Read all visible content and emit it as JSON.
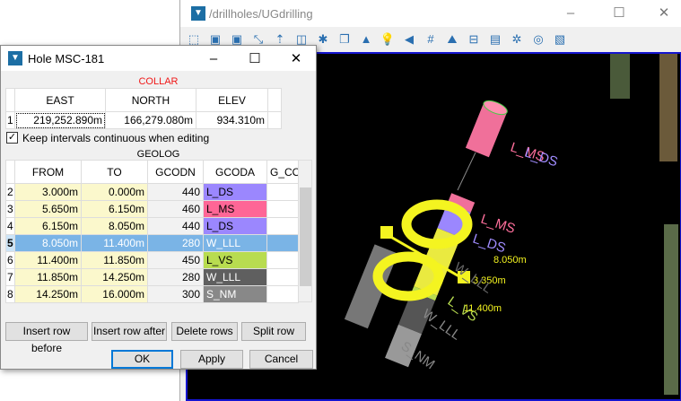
{
  "main_window": {
    "title": "/drillholes/UGdrilling"
  },
  "scene": {
    "labels": [
      "L_MS",
      "L_DS",
      "L_MS",
      "L_DS",
      "8.050m",
      "3.350m",
      "11.400m",
      "W_LLL",
      "L_VS",
      "W_LLL",
      "S_NM"
    ]
  },
  "dialog": {
    "title": "Hole MSC-181",
    "collar": {
      "title": "COLLAR",
      "columns": [
        "EAST",
        "NORTH",
        "ELEV"
      ],
      "row": {
        "num": "1",
        "east": "219,252.890m",
        "north": "166,279.080m",
        "elev": "934.310m"
      }
    },
    "keep_continuous": {
      "label": "Keep intervals continuous when editing",
      "checked": true
    },
    "geolog": {
      "title": "GEOLOG",
      "columns": [
        "FROM",
        "TO",
        "GCODN",
        "GCODA",
        "G_CO"
      ],
      "rows": [
        {
          "num": "2",
          "from": "3.000m",
          "to": "0.000m",
          "gcodn": "440",
          "gcoda": "L_DS",
          "color": "#9b87fe"
        },
        {
          "num": "3",
          "from": "5.650m",
          "to": "6.150m",
          "gcodn": "460",
          "gcoda": "L_MS",
          "color": "#fe6696"
        },
        {
          "num": "4",
          "from": "6.150m",
          "to": "8.050m",
          "gcodn": "440",
          "gcoda": "L_DS",
          "color": "#9b87fe"
        },
        {
          "num": "5",
          "from": "8.050m",
          "to": "11.400m",
          "gcodn": "280",
          "gcoda": "W_LLL",
          "color": "#7ab4e6"
        },
        {
          "num": "6",
          "from": "11.400m",
          "to": "11.850m",
          "gcodn": "450",
          "gcoda": "L_VS",
          "color": "#b8dc50"
        },
        {
          "num": "7",
          "from": "11.850m",
          "to": "14.250m",
          "gcodn": "280",
          "gcoda": "W_LLL",
          "color": "#5f5f5f"
        },
        {
          "num": "8",
          "from": "14.250m",
          "to": "16.000m",
          "gcodn": "300",
          "gcoda": "S_NM",
          "color": "#888888"
        }
      ]
    },
    "buttons": {
      "insert_before": "Insert row before",
      "insert_after": "Insert row after",
      "delete": "Delete rows",
      "split": "Split row",
      "ok": "OK",
      "apply": "Apply",
      "cancel": "Cancel"
    }
  }
}
